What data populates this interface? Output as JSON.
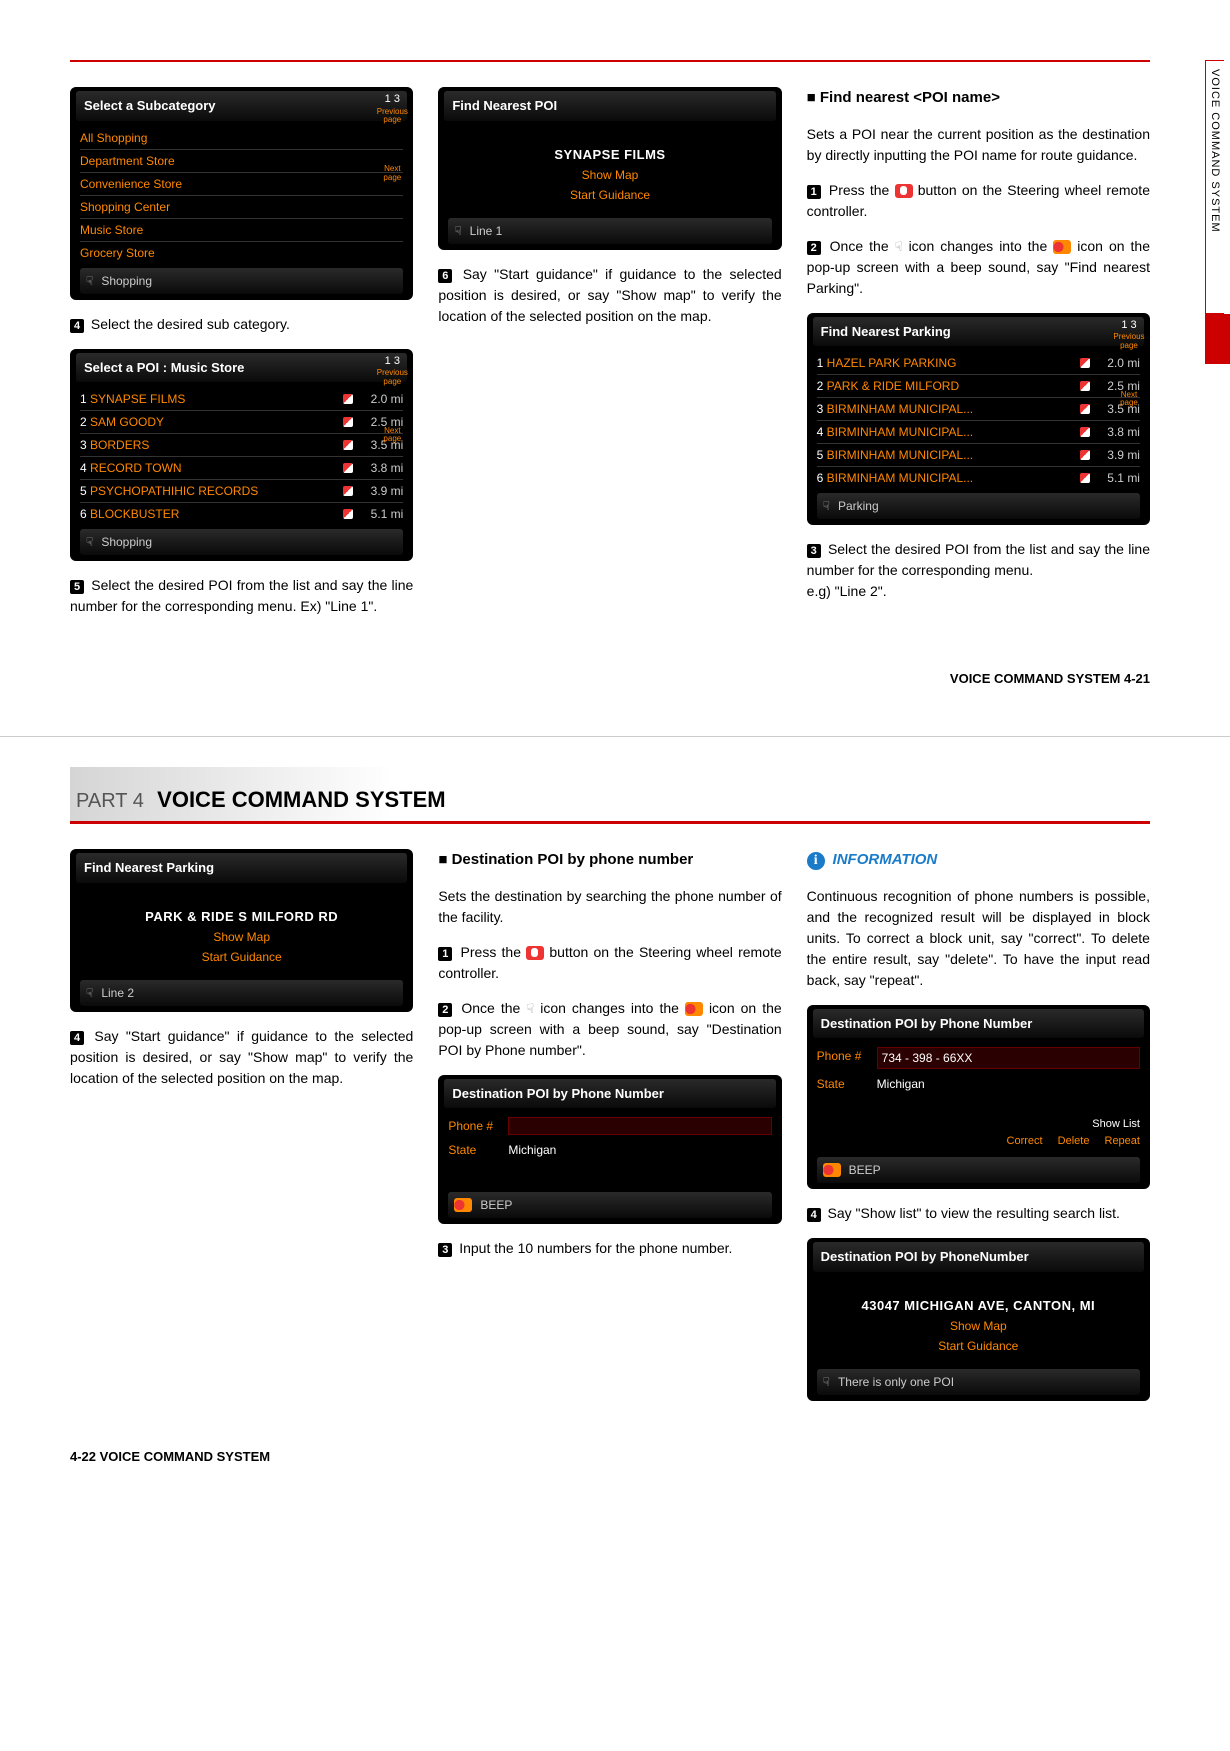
{
  "sideTab": "VOICE COMMAND SYSTEM",
  "page1": {
    "footer": "VOICE COMMAND SYSTEM   4-21",
    "col1": {
      "card1": {
        "title": "Select a Subcategory",
        "items": [
          "All Shopping",
          "Department Store",
          "Convenience Store",
          "Shopping Center",
          "Music Store",
          "Grocery Store"
        ],
        "pagerTop": "1   3",
        "pagerPrev": "Previous page",
        "pagerNext": "Next page",
        "footIcon": "pointer-icon",
        "footText": "Shopping"
      },
      "step4_num": "4",
      "step4": "Select the desired sub category.",
      "card2": {
        "title": "Select a POI : Music Store",
        "rows": [
          {
            "n": "1",
            "name": "SYNAPSE FILMS",
            "dist": "2.0 mi"
          },
          {
            "n": "2",
            "name": "SAM GOODY",
            "dist": "2.5 mi"
          },
          {
            "n": "3",
            "name": "BORDERS",
            "dist": "3.5 mi"
          },
          {
            "n": "4",
            "name": "RECORD TOWN",
            "dist": "3.8 mi"
          },
          {
            "n": "5",
            "name": "PSYCHOPATHIHIC RECORDS",
            "dist": "3.9 mi"
          },
          {
            "n": "6",
            "name": "BLOCKBUSTER",
            "dist": "5.1 mi"
          }
        ],
        "pagerTop": "1   3",
        "pagerPrev": "Previous page",
        "pagerNext": "Next page",
        "footText": "Shopping"
      },
      "step5_num": "5",
      "step5": "Select the desired POI from the list and say the line number for the corresponding menu. Ex) \"Line 1\"."
    },
    "col2": {
      "card": {
        "title": "Find Nearest POI",
        "big": "SYNAPSE FILMS",
        "o1": "Show Map",
        "o2": "Start Guidance",
        "footText": "Line 1"
      },
      "step6_num": "6",
      "step6": "Say \"Start guidance\" if guidance to the selected position is desired, or say \"Show map\" to verify the location of the selected position on the map."
    },
    "col3": {
      "heading": "Find nearest <POI name>",
      "intro": "Sets a POI near the current position as the destination by directly inputting the POI name for route guidance.",
      "s1_num": "1",
      "s1a": "Press the ",
      "s1b": " button on the Steering wheel remote controller.",
      "s2_num": "2",
      "s2a": "Once the ",
      "s2b": " icon changes into the ",
      "s2c": " icon on the pop-up screen with a beep sound, say \"Find nearest Parking\".",
      "card": {
        "title": "Find Nearest Parking",
        "rows": [
          {
            "n": "1",
            "name": "HAZEL PARK PARKING",
            "dist": "2.0 mi"
          },
          {
            "n": "2",
            "name": "PARK & RIDE MILFORD",
            "dist": "2.5 mi"
          },
          {
            "n": "3",
            "name": "BIRMINHAM MUNICIPAL...",
            "dist": "3.5 mi"
          },
          {
            "n": "4",
            "name": "BIRMINHAM MUNICIPAL...",
            "dist": "3.8 mi"
          },
          {
            "n": "5",
            "name": "BIRMINHAM MUNICIPAL...",
            "dist": "3.9 mi"
          },
          {
            "n": "6",
            "name": "BIRMINHAM MUNICIPAL...",
            "dist": "5.1 mi"
          }
        ],
        "pagerTop": "1   3",
        "pagerPrev": "Previous page",
        "pagerNext": "Next page",
        "footText": "Parking"
      },
      "s3_num": "3",
      "s3": "Select the desired POI from the list and say the line number for the corresponding menu.",
      "s3b": "e.g) \"Line 2\"."
    }
  },
  "page2": {
    "partLabel": "PART 4",
    "partTitle": "VOICE COMMAND SYSTEM",
    "footer": "4-22  VOICE COMMAND SYSTEM",
    "col1": {
      "card": {
        "title": "Find Nearest Parking",
        "big": "PARK & RIDE S MILFORD RD",
        "o1": "Show Map",
        "o2": "Start Guidance",
        "footText": "Line 2"
      },
      "s4_num": "4",
      "s4": "Say \"Start guidance\" if guidance to the selected position is desired, or say \"Show map\" to verify the location of the selected position on the map."
    },
    "col2": {
      "heading": "Destination POI by phone number",
      "intro": "Sets the destination by searching the phone number of the facility.",
      "s1_num": "1",
      "s1a": "Press the ",
      "s1b": " button on the Steering wheel remote controller.",
      "s2_num": "2",
      "s2a": "Once the ",
      "s2b": " icon changes into the ",
      "s2c": " icon on the pop-up screen with a beep sound, say \"Destination POI by Phone number\".",
      "card": {
        "title": "Destination POI by Phone Number",
        "k1": "Phone #",
        "v1": "",
        "k2": "State",
        "v2": "Michigan",
        "beep": "BEEP"
      },
      "s3_num": "3",
      "s3": "Input the 10 numbers for the phone number."
    },
    "col3": {
      "infoTitle": "INFORMATION",
      "infoBody": "Continuous recognition of phone numbers is possible, and the recognized result will be displayed in block units. To correct a block unit, say \"correct\". To delete the entire result, say \"delete\". To have the input read back, say \"repeat\".",
      "card1": {
        "title": "Destination POI by Phone Number",
        "k1": "Phone #",
        "v1": "734 - 398 - 66XX",
        "k2": "State",
        "v2": "Michigan",
        "btnShow": "Show List",
        "btnCor": "Correct",
        "btnDel": "Delete",
        "btnRep": "Repeat",
        "beep": "BEEP"
      },
      "s4_num": "4",
      "s4": "Say \"Show list\" to view the resulting search list.",
      "card2": {
        "title": "Destination POI by PhoneNumber",
        "big": "43047 MICHIGAN AVE, CANTON, MI",
        "o1": "Show Map",
        "o2": "Start Guidance",
        "footText": "There is only one POI"
      }
    }
  }
}
